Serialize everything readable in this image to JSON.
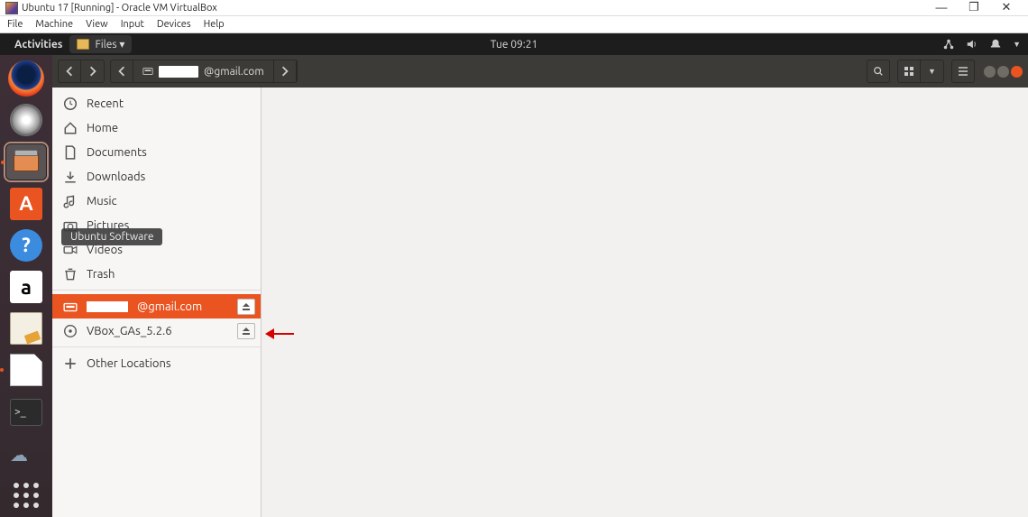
{
  "host": {
    "title": "Ubuntu 17 [Running] - Oracle VM VirtualBox",
    "menu": [
      "File",
      "Machine",
      "View",
      "Input",
      "Devices",
      "Help"
    ],
    "win_buttons": {
      "min": "—",
      "max": "❐",
      "close": "✕"
    }
  },
  "topbar": {
    "activities": "Activities",
    "app_label": "Files ▾",
    "clock": "Tue 09:21"
  },
  "tooltip": "Ubuntu Software",
  "dock": {
    "items": [
      {
        "name": "firefox"
      },
      {
        "name": "rhythmbox"
      },
      {
        "name": "files",
        "active": true
      },
      {
        "name": "ubuntu-software"
      },
      {
        "name": "help"
      },
      {
        "name": "amazon"
      },
      {
        "name": "text-editor"
      },
      {
        "name": "libreoffice",
        "indicator": true
      },
      {
        "name": "terminal"
      },
      {
        "name": "weather"
      }
    ],
    "show_apps": "show-applications"
  },
  "files_toolbar": {
    "path_suffix": "@gmail.com"
  },
  "sidebar": {
    "items": [
      {
        "icon": "clock",
        "label": "Recent"
      },
      {
        "icon": "home",
        "label": "Home"
      },
      {
        "icon": "doc",
        "label": "Documents"
      },
      {
        "icon": "download",
        "label": "Downloads"
      },
      {
        "icon": "music",
        "label": "Music"
      },
      {
        "icon": "camera",
        "label": "Pictures"
      },
      {
        "icon": "video",
        "label": "Videos"
      },
      {
        "icon": "trash",
        "label": "Trash"
      }
    ],
    "mounts": [
      {
        "icon": "drive",
        "label_suffix": "@gmail.com",
        "selected": true,
        "ejectable": true,
        "redacted": true
      },
      {
        "icon": "disc",
        "label": "VBox_GAs_5.2.6",
        "ejectable": true
      }
    ],
    "other": {
      "icon": "plus",
      "label": "Other Locations"
    }
  }
}
